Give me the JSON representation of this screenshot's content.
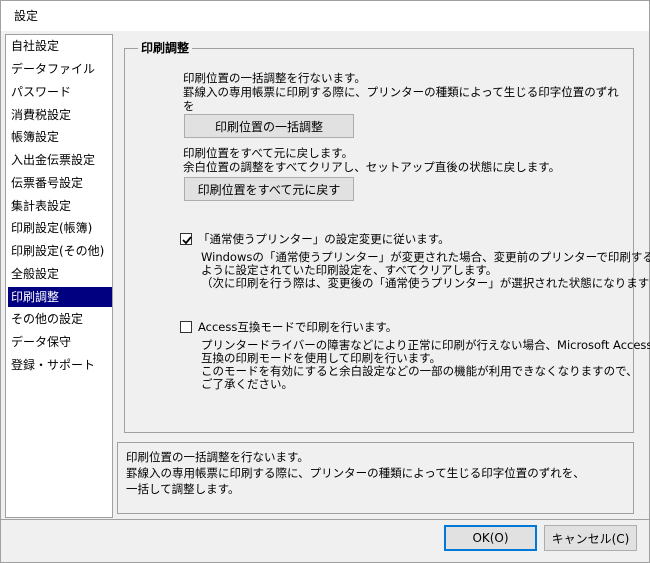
{
  "window": {
    "title": "設定"
  },
  "sidebar": {
    "items": [
      {
        "label": "自社設定"
      },
      {
        "label": "データファイル"
      },
      {
        "label": "パスワード"
      },
      {
        "label": "消費税設定"
      },
      {
        "label": "帳簿設定"
      },
      {
        "label": "入出金伝票設定"
      },
      {
        "label": "伝票番号設定"
      },
      {
        "label": "集計表設定"
      },
      {
        "label": "印刷設定(帳簿)"
      },
      {
        "label": "印刷設定(その他)"
      },
      {
        "label": "全般設定"
      },
      {
        "label": "印刷調整",
        "selected": true
      },
      {
        "label": "その他の設定"
      },
      {
        "label": "データ保守"
      },
      {
        "label": "登録・サポート"
      }
    ]
  },
  "main": {
    "title": "印刷調整",
    "bulk_adjust": {
      "line1": "印刷位置の一括調整を行ないます。",
      "line2": "罫線入の専用帳票に印刷する際に、プリンターの種類によって生じる印字位置のずれ",
      "line3": "を",
      "button": "印刷位置の一括調整"
    },
    "reset": {
      "line1": "印刷位置をすべて元に戻します。",
      "line2": "余白位置の調整をすべてクリアし、セットアップ直後の状態に戻します。",
      "button": "印刷位置をすべて元に戻す"
    },
    "default_printer": {
      "checked": true,
      "label": "「通常使うプリンター」の設定変更に従います。",
      "desc1": "Windowsの「通常使うプリンター」が変更された場合、変更前のプリンターで印刷する",
      "desc2": "ように設定されていた印刷設定を、すべてクリアします。",
      "desc3": "（次に印刷を行う際は、変更後の「通常使うプリンター」が選択された状態になります）"
    },
    "access_compat": {
      "checked": false,
      "label": "Access互換モードで印刷を行います。",
      "desc1": "プリンタードライバーの障害などにより正常に印刷が行えない場合、Microsoft Access",
      "desc2": "互換の印刷モードを使用して印刷を行います。",
      "desc3": "このモードを有効にすると余白設定などの一部の機能が利用できなくなりますので、",
      "desc4": "ご了承ください。"
    }
  },
  "description": {
    "line1": "印刷位置の一括調整を行ないます。",
    "line2": "罫線入の専用帳票に印刷する際に、プリンターの種類によって生じる印字位置のずれを、",
    "line3": "一括して調整します。"
  },
  "footer": {
    "ok_label": "OK(O)",
    "cancel_label": "キャンセル(C)"
  }
}
